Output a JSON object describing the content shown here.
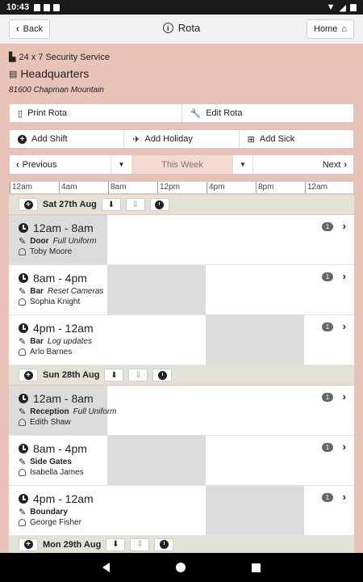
{
  "status": {
    "time": "10:43"
  },
  "topbar": {
    "back_label": "Back",
    "title": "Rota",
    "home_label": "Home"
  },
  "header": {
    "company": "24 x 7 Security Service",
    "site": "Headquarters",
    "address": "81600 Chapman Mountain"
  },
  "actions": {
    "print": "Print Rota",
    "edit": "Edit Rota"
  },
  "adds": {
    "shift": "Add Shift",
    "holiday": "Add Holiday",
    "sick": "Add Sick"
  },
  "weeknav": {
    "previous": "Previous",
    "week": "This Week",
    "next": "Next"
  },
  "ruler": [
    "12am",
    "4am",
    "8am",
    "12pm",
    "4pm",
    "8pm",
    "12am"
  ],
  "days": [
    {
      "label": "Sat 27th Aug",
      "shifts": [
        {
          "time": "12am - 8am",
          "role": "Door",
          "note": "Full Uniform",
          "person": "Toby Moore",
          "count": "1",
          "start": 0,
          "end": 8
        },
        {
          "time": "8am - 4pm",
          "role": "Bar",
          "note": "Reset Cameras",
          "person": "Sophia Knight",
          "count": "1",
          "start": 8,
          "end": 16
        },
        {
          "time": "4pm - 12am",
          "role": "Bar",
          "note": "Log updates",
          "person": "Arlo Barnes",
          "count": "1",
          "start": 16,
          "end": 24
        }
      ]
    },
    {
      "label": "Sun 28th Aug",
      "shifts": [
        {
          "time": "12am - 8am",
          "role": "Reception",
          "note": "Full Uniform",
          "person": "Edith Shaw",
          "count": "1",
          "start": 0,
          "end": 8
        },
        {
          "time": "8am - 4pm",
          "role": "Side Gates",
          "note": "",
          "person": "Isabella James",
          "count": "1",
          "start": 8,
          "end": 16
        },
        {
          "time": "4pm - 12am",
          "role": "Boundary",
          "note": "",
          "person": "George Fisher",
          "count": "1",
          "start": 16,
          "end": 24
        }
      ]
    },
    {
      "label": "Mon 29th Aug",
      "shifts": []
    }
  ],
  "colors": {
    "background": "#eac3b8",
    "day_header": "#e2e2d6",
    "shift_bar": "#dcdcdc"
  }
}
